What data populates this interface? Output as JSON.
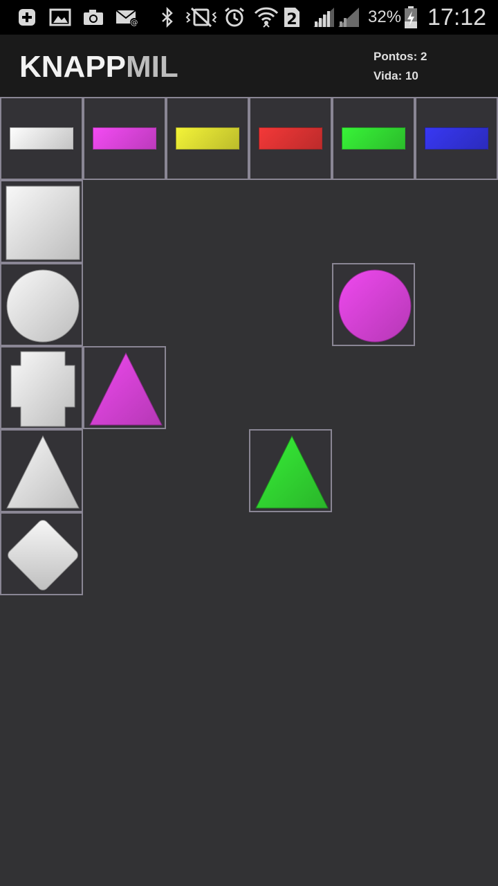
{
  "status_bar": {
    "icons": [
      "add-icon",
      "image-icon",
      "camera-icon",
      "email-icon",
      "bluetooth-icon",
      "vibrate-icon",
      "alarm-icon",
      "wifi-icon",
      "sim-2-icon",
      "signal-icon",
      "signal-icon",
      "battery-charging-icon"
    ],
    "battery": "32%",
    "sim_slot": "2",
    "time": "17:12"
  },
  "header": {
    "title_part1": "KNAPP",
    "title_part2": "MIL",
    "score": "Pontos: 2",
    "life": "Vida: 10"
  },
  "palette_colors": [
    {
      "name": "white",
      "hex": "#e6e6e6"
    },
    {
      "name": "magenta",
      "hex": "#dd44dd"
    },
    {
      "name": "yellow",
      "hex": "#dddd33"
    },
    {
      "name": "red",
      "hex": "#dd3333"
    },
    {
      "name": "green",
      "hex": "#33dd33"
    },
    {
      "name": "blue",
      "hex": "#3333dd"
    }
  ],
  "shape_column": [
    "square",
    "circle",
    "cross",
    "triangle",
    "diamond"
  ],
  "board_pieces": [
    {
      "shape": "circle",
      "color": "magenta",
      "row": 3,
      "col": 5
    },
    {
      "shape": "triangle",
      "color": "magenta",
      "row": 4,
      "col": 2
    },
    {
      "shape": "triangle",
      "color": "green",
      "row": 5,
      "col": 4
    }
  ],
  "colors": {
    "board_bg": "#323234",
    "cell_border": "#8a8694",
    "appbar_bg": "#1a1a1a",
    "statusbar_bg": "#000000"
  }
}
